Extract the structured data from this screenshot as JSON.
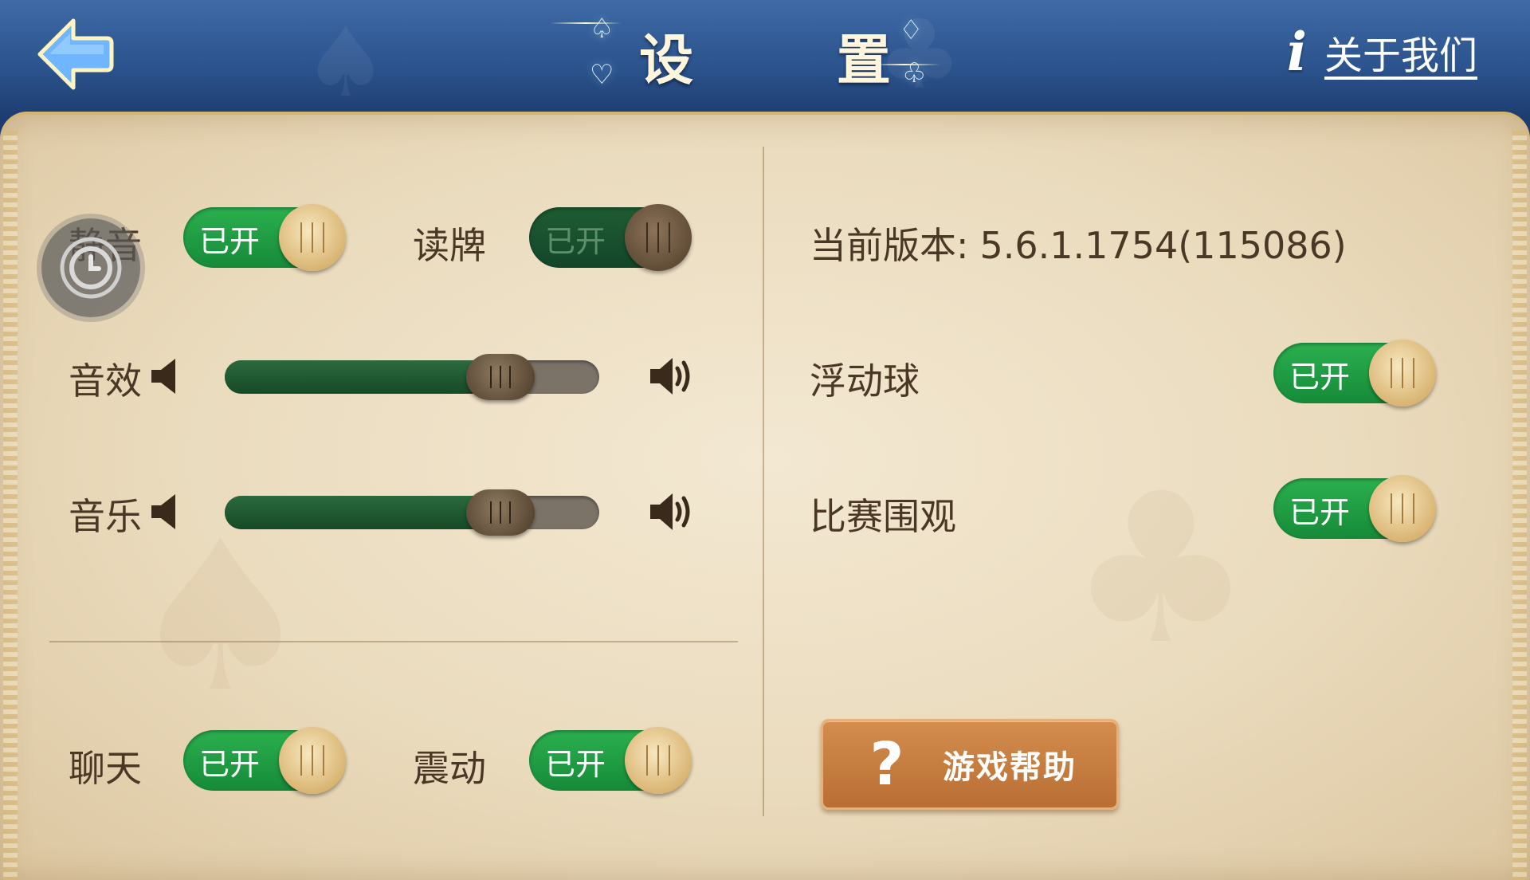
{
  "header": {
    "title": "设 置",
    "about_label": "关于我们",
    "about_icon": "info-icon",
    "back_icon": "back-arrow-icon"
  },
  "left": {
    "mute": {
      "label": "静音",
      "state": "已开",
      "on": true
    },
    "read_cards": {
      "label": "读牌",
      "state": "已开",
      "on": false
    },
    "sound_effect": {
      "label": "音效",
      "level": 0.81
    },
    "music": {
      "label": "音乐",
      "level": 0.81
    },
    "chat": {
      "label": "聊天",
      "state": "已开",
      "on": true
    },
    "vibrate": {
      "label": "震动",
      "state": "已开",
      "on": true
    }
  },
  "right": {
    "version_label": "当前版本:",
    "version_value": "5.6.1.1754(115086)",
    "float_ball": {
      "label": "浮动球",
      "state": "已开",
      "on": true
    },
    "match_spectate": {
      "label": "比赛围观",
      "state": "已开",
      "on": true
    },
    "help_button": "游戏帮助",
    "help_icon": "question-icon"
  },
  "colors": {
    "header": "#2c548e",
    "panel": "#eadbbd",
    "toggle_on": "#1f9e45",
    "help_button": "#c67d40",
    "text": "#4b3726"
  }
}
